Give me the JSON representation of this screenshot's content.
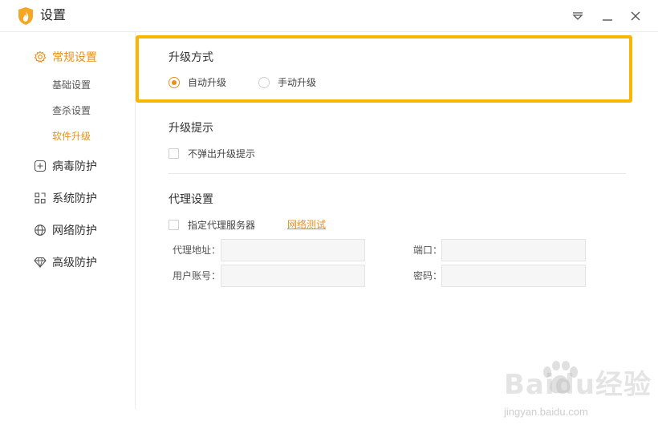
{
  "window": {
    "title": "设置"
  },
  "sidebar": {
    "sections": [
      {
        "label": "常规设置",
        "icon": "gear-icon",
        "active": true
      },
      {
        "label": "病毒防护",
        "icon": "plus-square-icon"
      },
      {
        "label": "系统防护",
        "icon": "grid-icon"
      },
      {
        "label": "网络防护",
        "icon": "globe-icon"
      },
      {
        "label": "高级防护",
        "icon": "diamond-icon"
      }
    ],
    "subitems": [
      "基础设置",
      "查杀设置",
      "软件升级"
    ],
    "active_subitem": "软件升级"
  },
  "upgrade_mode": {
    "title": "升级方式",
    "options": [
      "自动升级",
      "手动升级"
    ],
    "selected": "自动升级"
  },
  "upgrade_prompt": {
    "title": "升级提示",
    "checkbox_label": "不弹出升级提示",
    "checked": false
  },
  "proxy": {
    "title": "代理设置",
    "checkbox_label": "指定代理服务器",
    "checked": false,
    "test_link": "网络测试",
    "fields": {
      "address_label": "代理地址：",
      "port_label": "端口：",
      "username_label": "用户账号：",
      "password_label": "密码："
    }
  },
  "watermark": {
    "brand": "Baidu经验",
    "url": "jingyan.baidu.com"
  },
  "colors": {
    "accent": "#e8901c",
    "highlight": "#f9b600"
  }
}
